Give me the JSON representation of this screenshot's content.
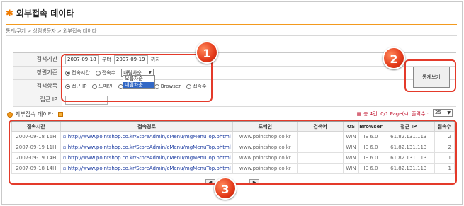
{
  "page": {
    "title": "외부접속 데이타",
    "breadcrumb": "통계/쿠기 > 상점방문자 > 외부접속 데이타"
  },
  "search": {
    "period_label": "검색기간",
    "date_from": "2007-09-18",
    "from_suffix": "부터",
    "date_to": "2007-09-19",
    "to_suffix": "까지",
    "sort_label": "정렬기준",
    "sort_options": [
      "접속시간",
      "접속수"
    ],
    "sort_order": "내림차순",
    "sort_dropdown": [
      "오름차순",
      "내림차순"
    ],
    "item_label": "검색항목",
    "item_options": [
      "접근 IP",
      "도메인",
      "",
      "Browser",
      "접속수"
    ],
    "ip_label": "접근 IP",
    "stat_button": "통계보기"
  },
  "section": {
    "title": "외부접속 데이타",
    "summary": "총 4건, 0/1 Page(s), 출력수 :",
    "page_size": "25"
  },
  "table": {
    "headers": [
      "접속시간",
      "접속경로",
      "도메인",
      "검색어",
      "OS",
      "Browser",
      "접근 IP",
      "접속수"
    ],
    "rows": [
      {
        "time": "2007-09-18 16H",
        "url": "http://www.pointshop.co.kr/StoreAdmin/cMenu/mgMenuTop.phtml",
        "domain": "www.pointshop.co.kr",
        "keyword": "",
        "os": "WIN",
        "browser": "IE 6.0",
        "ip": "61.82.131.113",
        "count": "2"
      },
      {
        "time": "2007-09-19 11H",
        "url": "http://www.pointshop.co.kr/StoreAdmin/cMenu/mgMenuTop.phtml",
        "domain": "www.pointshop.co.kr",
        "keyword": "",
        "os": "WIN",
        "browser": "IE 6.0",
        "ip": "61.82.131.113",
        "count": "2"
      },
      {
        "time": "2007-09-19 14H",
        "url": "http://www.pointshop.co.kr/StoreAdmin/cMenu/mgMenuTop.phtml",
        "domain": "www.pointshop.co.kr",
        "keyword": "",
        "os": "WIN",
        "browser": "IE 6.0",
        "ip": "61.82.131.113",
        "count": "1"
      },
      {
        "time": "2007-09-18 14H",
        "url": "http://www.pointshop.co.kr/StoreAdmin/cMenu/mgMenuTop.phtml",
        "domain": "www.pointshop.co.kr",
        "keyword": "",
        "os": "WIN",
        "browser": "IE 6.0",
        "ip": "61.82.131.113",
        "count": "1"
      }
    ]
  },
  "callouts": [
    "1",
    "2",
    "3"
  ],
  "colors": {
    "accent": "#f39a1e",
    "highlight": "#e43a2a",
    "link": "#1a3aa0"
  }
}
